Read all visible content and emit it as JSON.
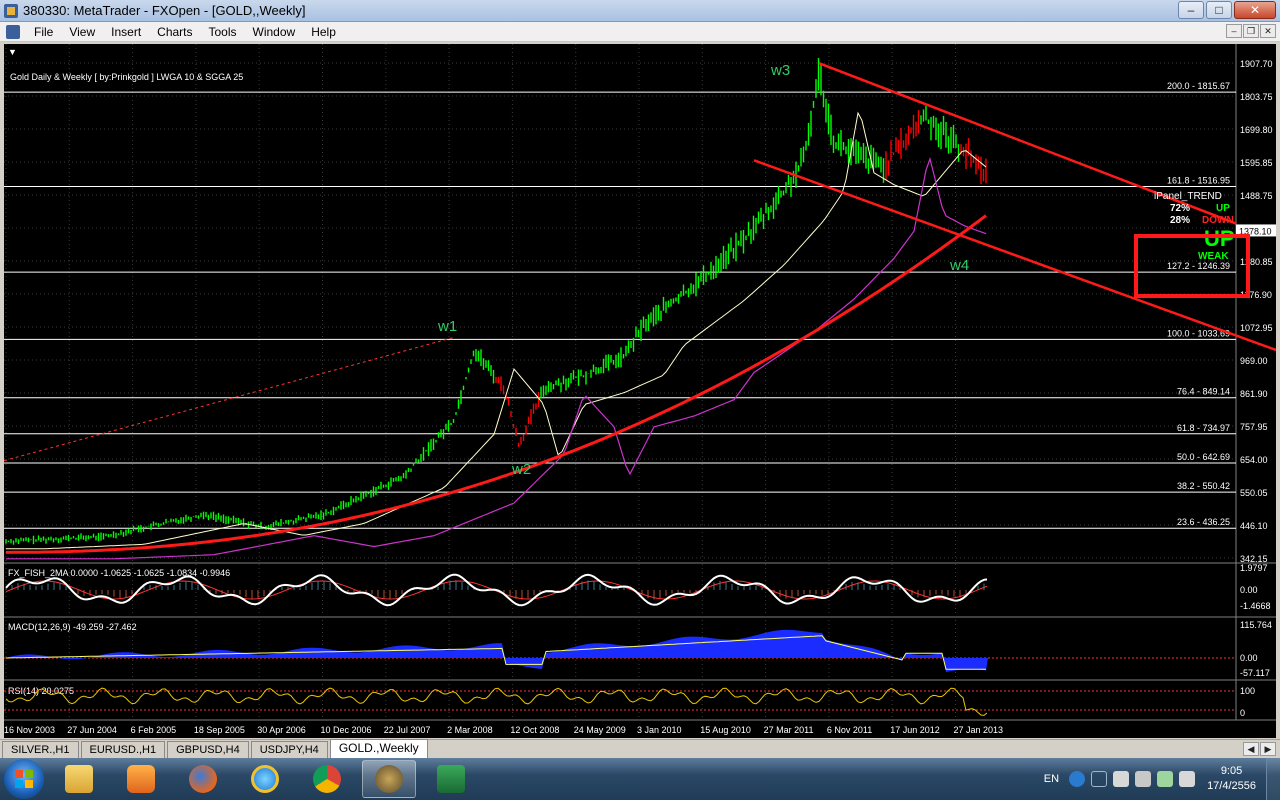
{
  "window": {
    "title": "380330: MetaTrader - FXOpen - [GOLD,,Weekly]",
    "min": "–",
    "max": "□",
    "close": "✕"
  },
  "menu": [
    "File",
    "View",
    "Insert",
    "Charts",
    "Tools",
    "Window",
    "Help"
  ],
  "chart": {
    "header": "Gold Daily & Weekly [ by:Prinkgold ] LWGA 10  &  SGGA 25",
    "price_axis": [
      "1907.70",
      "1803.75",
      "1699.80",
      "1595.85",
      "1488.75",
      "1378.10",
      "1280.85",
      "1176.90",
      "1072.95",
      "969.00",
      "861.90",
      "757.95",
      "654.00",
      "550.05",
      "446.10",
      "342.15"
    ],
    "current_price": "1378.10",
    "fib_levels": [
      {
        "label": "200.0 - 1815.67",
        "price": 1815.67
      },
      {
        "label": "161.8 - 1516.95",
        "price": 1516.95
      },
      {
        "label": "127.2 - 1246.39",
        "price": 1246.39
      },
      {
        "label": "100.0 - 1033.69",
        "price": 1033.69
      },
      {
        "label": "76.4 - 849.14",
        "price": 849.14
      },
      {
        "label": "61.8 - 734.97",
        "price": 734.97
      },
      {
        "label": "50.0 - 642.69",
        "price": 642.69
      },
      {
        "label": "38.2 - 550.42",
        "price": 550.42
      },
      {
        "label": "23.6 - 436.25",
        "price": 436.25
      }
    ],
    "waves": [
      "w1",
      "w2",
      "w3",
      "w4"
    ],
    "ipanel": {
      "title": "iPanel_TREND",
      "up_pct": "72%",
      "up_label": "UP",
      "down_pct": "28%",
      "down_label": "DOWN",
      "trend_word": "UP",
      "strength": "WEAK"
    },
    "dates": [
      "16 Nov 2003",
      "27 Jun 2004",
      "6 Feb 2005",
      "18 Sep 2005",
      "30 Apr 2006",
      "10 Dec 2006",
      "22 Jul 2007",
      "2 Mar 2008",
      "12 Oct 2008",
      "24 May 2009",
      "3 Jan 2010",
      "15 Aug 2010",
      "27 Mar 2011",
      "6 Nov 2011",
      "17 Jun 2012",
      "27 Jan 2013"
    ],
    "fisher": {
      "label": "FX_FISH_2MA 0.0000 -1.0625 -1.0625 -1.0834 -0.9946",
      "axis": [
        "1.9797",
        "0.00",
        "-1.4668"
      ]
    },
    "macd": {
      "label": "MACD(12,26,9) -49.259 -27.462",
      "axis": [
        "115.764",
        "0.00",
        "-57.117"
      ]
    },
    "rsi": {
      "label": "RSI(14) 20.0275",
      "axis": [
        "100",
        "0"
      ]
    },
    "colors": {
      "bull": "#00ff00",
      "bear": "#ff0000",
      "ma_slow": "#ff1a1a",
      "ma_mid": "#cc33cc",
      "ma_fast": "#ffffcc",
      "fib": "#ffffff",
      "wave": "#33cc66"
    }
  },
  "tabs": [
    "SILVER.,H1",
    "EURUSD.,H1",
    "GBPUSD,H4",
    "USDJPY,H4",
    "GOLD.,Weekly"
  ],
  "taskbar": {
    "apps": [
      "explorer-icon",
      "media-player-icon",
      "firefox-icon",
      "ie-icon",
      "chrome-icon",
      "metatrader-icon",
      "excel-icon"
    ],
    "lang": "EN",
    "time": "9:05",
    "date": "17/4/2556"
  }
}
